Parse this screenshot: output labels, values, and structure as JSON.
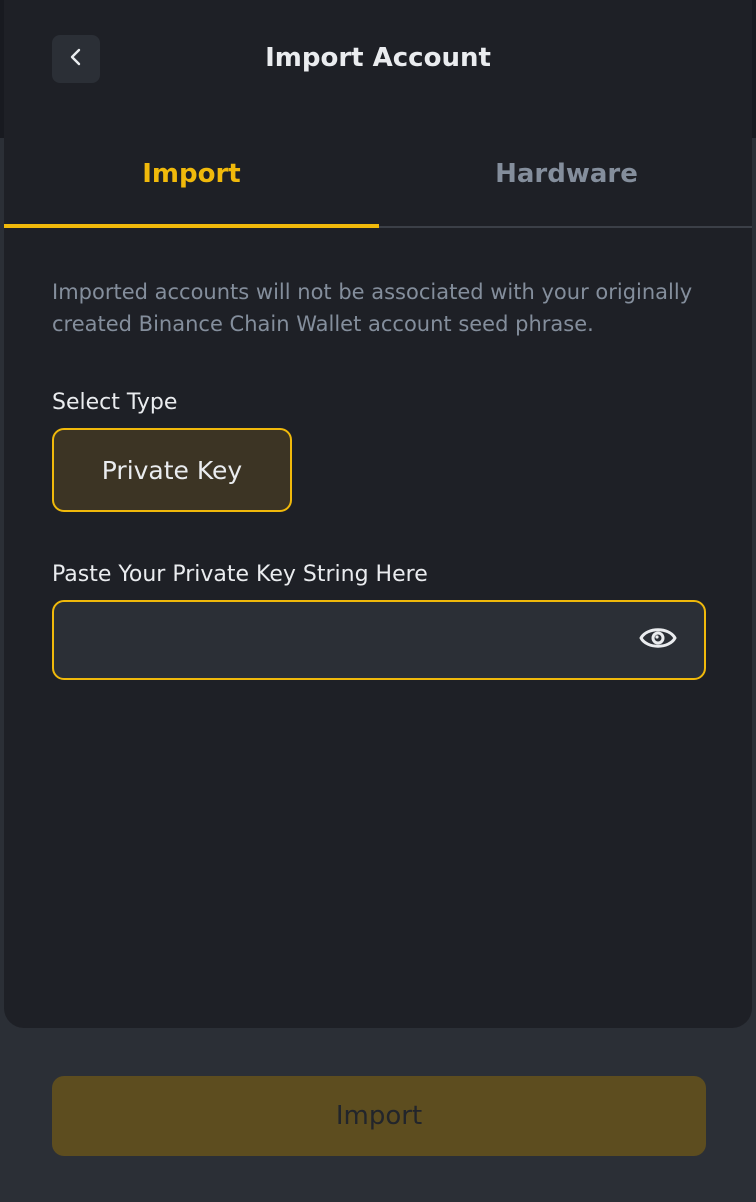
{
  "header": {
    "title": "Import Account",
    "back_icon": "chevron-left-icon"
  },
  "tabs": [
    {
      "label": "Import",
      "active": true
    },
    {
      "label": "Hardware",
      "active": false
    }
  ],
  "notice": "Imported accounts will not be associated with your originally created Binance Chain Wallet account seed phrase.",
  "select_type": {
    "label": "Select Type",
    "selected": "Private Key"
  },
  "private_key": {
    "label": "Paste Your Private Key String Here",
    "value": "",
    "toggle_icon": "eye-icon"
  },
  "import_button": {
    "label": "Import",
    "disabled": true
  },
  "colors": {
    "accent": "#f0b90b",
    "background": "#1e2026",
    "muted_text": "#848e9c",
    "primary_text": "#eaecef"
  }
}
